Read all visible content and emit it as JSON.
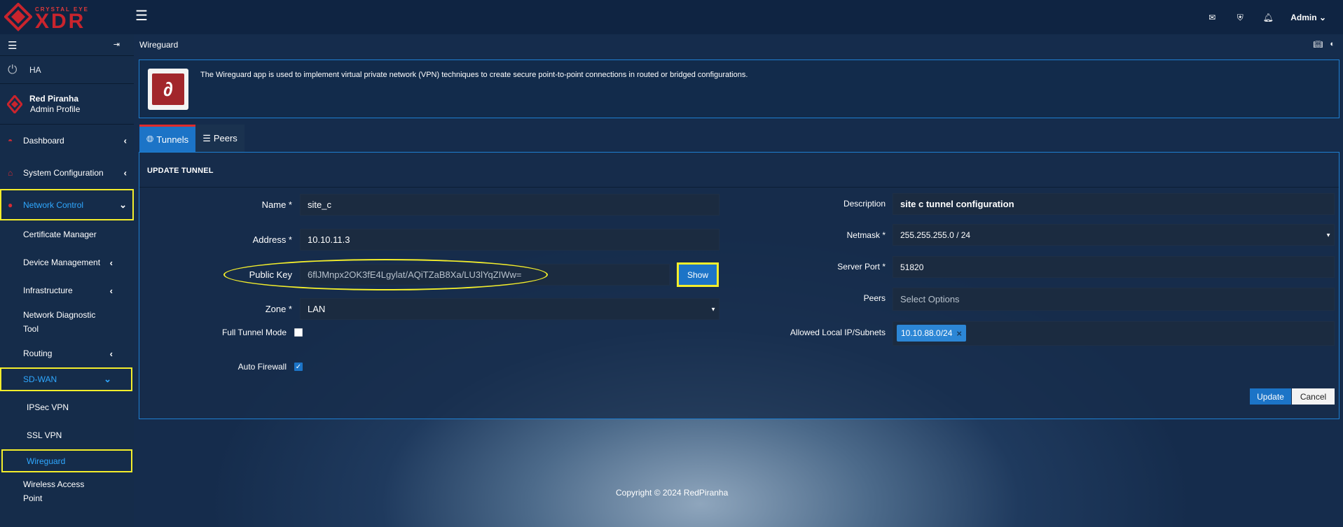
{
  "brand": {
    "small": "CRYSTAL EYE",
    "big": "XDR"
  },
  "topbar": {
    "admin_label": "Admin"
  },
  "sidebar": {
    "ha_label": "HA",
    "profile_name": "Red Piranha",
    "profile_role": "Admin Profile",
    "items": {
      "dashboard": "Dashboard",
      "system_configuration": "System Configuration",
      "network_control": "Network Control",
      "certificate_manager": "Certificate Manager",
      "device_management": "Device Management",
      "infrastructure": "Infrastructure",
      "network_diagnostic_1": "Network Diagnostic",
      "network_diagnostic_2": "Tool",
      "routing": "Routing",
      "sdwan": "SD-WAN",
      "ipsec_vpn": "IPSec VPN",
      "ssl_vpn": "SSL VPN",
      "wireguard": "Wireguard",
      "wireless_1": "Wireless Access",
      "wireless_2": "Point"
    }
  },
  "page": {
    "breadcrumb": "Wireguard",
    "info_text": "The Wireguard app is used to implement virtual private network (VPN) techniques to create secure point-to-point connections in routed or bridged configurations.",
    "tabs": {
      "tunnels": "Tunnels",
      "peers": "Peers"
    },
    "panel_title": "UPDATE TUNNEL"
  },
  "form": {
    "name_label": "Name *",
    "name_value": "site_c",
    "address_label": "Address *",
    "address_value": "10.10.11.3",
    "public_key_label": "Public Key",
    "public_key_value": "6flJMnpx2OK3fE4Lgylat/AQiTZaB8Xa/LU3lYqZIWw=",
    "show_button": "Show",
    "zone_label": "Zone *",
    "zone_value": "LAN",
    "full_tunnel_label": "Full Tunnel Mode",
    "auto_firewall_label": "Auto Firewall",
    "description_label": "Description",
    "description_value": "site c tunnel configuration",
    "netmask_label": "Netmask *",
    "netmask_value": "255.255.255.0 / 24",
    "server_port_label": "Server Port *",
    "server_port_value": "51820",
    "peers_label": "Peers",
    "peers_placeholder": "Select Options",
    "allowed_label": "Allowed Local IP/Subnets",
    "allowed_tag": "10.10.88.0/24",
    "update_button": "Update",
    "cancel_button": "Cancel"
  },
  "footer": "Copyright © 2024 RedPiranha",
  "colors": {
    "accent": "#1c74c7",
    "highlight": "#f4ee2b",
    "brand_red": "#c9242d"
  }
}
